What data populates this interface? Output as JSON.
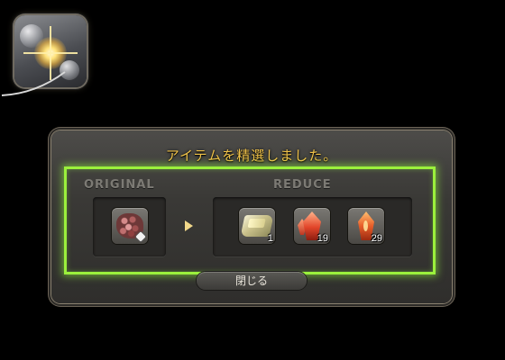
{
  "action_icon": {
    "icon": "desynthesis-sparkle-icon"
  },
  "dialog": {
    "title": "アイテムを精選しました。",
    "original_label": "ORIGINAL",
    "reduce_label": "REDUCE",
    "original_item": {
      "icon": "reddish-ore-cluster-icon",
      "hq": true
    },
    "results": [
      {
        "icon": "sand-bag-icon",
        "quantity": "1"
      },
      {
        "icon": "fire-crystal-icon",
        "quantity": "19"
      },
      {
        "icon": "fire-cluster-icon",
        "quantity": "29"
      }
    ],
    "close_label": "閉じる"
  },
  "colors": {
    "title": "#f0c24a",
    "highlight": "#9bf03c",
    "section_label": "#7c7a74",
    "arrow": "#f2d88a"
  }
}
